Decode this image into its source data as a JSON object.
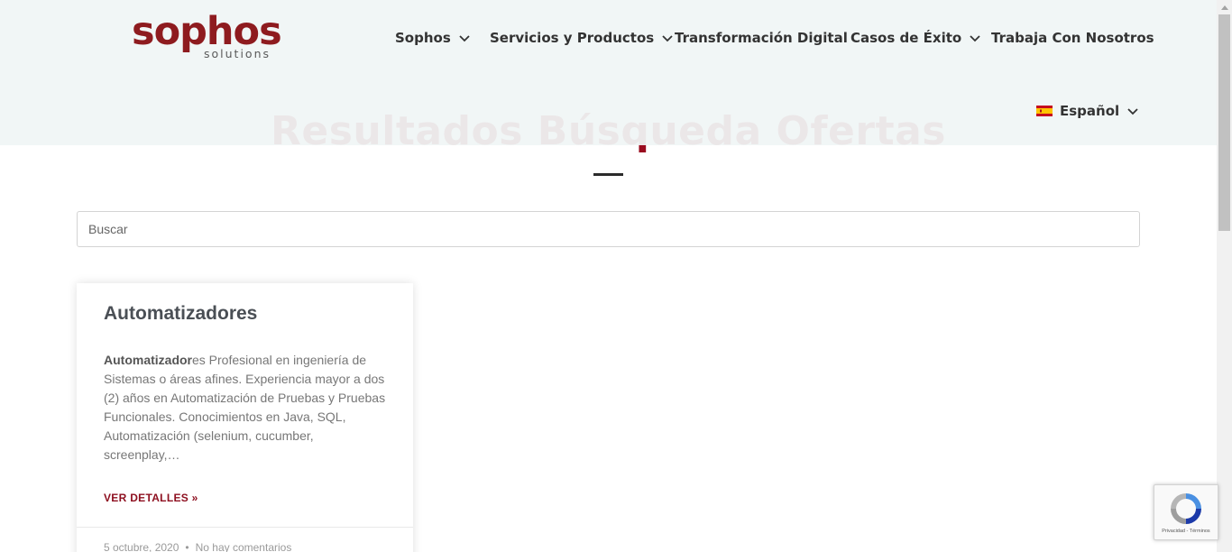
{
  "logo": {
    "main": "sophos",
    "sub": "solutions"
  },
  "nav": {
    "items": [
      {
        "label": "Sophos",
        "dropdown": true
      },
      {
        "label": "Servicios y Productos",
        "dropdown": true
      },
      {
        "label": "Transformación Digital",
        "dropdown": false
      },
      {
        "label": "Casos de Éxito",
        "dropdown": true
      },
      {
        "label": "Trabaja Con Nosotros",
        "dropdown": false
      }
    ],
    "language": {
      "label": "Español",
      "flag_icon": "spain-flag-icon"
    }
  },
  "page": {
    "title": "Resultados Búsqueda Ofertas"
  },
  "search": {
    "placeholder": "Buscar",
    "value": ""
  },
  "results": [
    {
      "title": "Automatizadores",
      "excerpt_highlight": "Automatizador",
      "excerpt_rest": "es Profesional en ingeniería de Sistemas o áreas afines. Experiencia mayor a dos (2) años en Automatización de Pruebas y Pruebas Funcionales. Conocimientos en Java, SQL, Automatización (selenium, cucumber, screenplay,…",
      "read_more": "VER DETALLES »",
      "date": "5 octubre, 2020",
      "separator": "•",
      "comments": "No hay comentarios"
    }
  ],
  "recaptcha": {
    "text": "Privacidad - Términos"
  },
  "colors": {
    "brand": "#8e1b1f",
    "title": "#9a0b1f",
    "link": "#8e1020"
  }
}
